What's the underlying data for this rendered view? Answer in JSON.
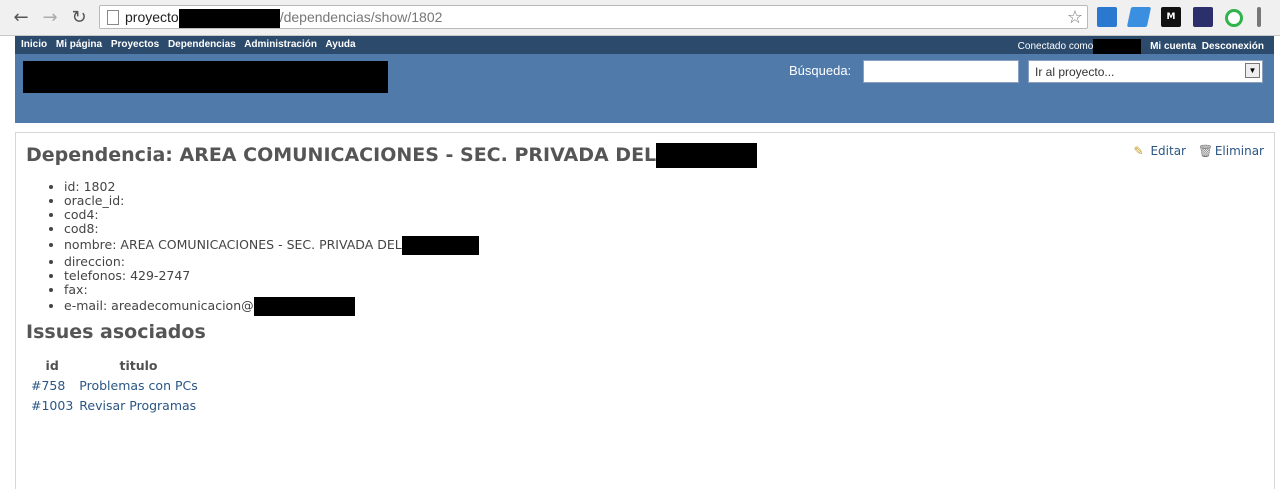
{
  "browser": {
    "url_host": "proyecto",
    "url_path": "/dependencias/show/1802"
  },
  "top_menu": {
    "items": [
      "Inicio",
      "Mi página",
      "Proyectos",
      "Dependencias",
      "Administración",
      "Ayuda"
    ],
    "logged_as": "Conectado como",
    "my_account": "Mi cuenta",
    "logout": "Desconexión"
  },
  "header": {
    "search_label": "Búsqueda:",
    "search_value": "",
    "jump_placeholder": "Ir al proyecto..."
  },
  "page": {
    "title": "Dependencia: AREA COMUNICACIONES - SEC. PRIVADA DEL",
    "edit_label": "Editar",
    "delete_label": "Eliminar",
    "details": [
      "id: 1802",
      "oracle_id:",
      "cod4:",
      "cod8:",
      "nombre: AREA COMUNICACIONES - SEC. PRIVADA DEL",
      "direccion:",
      "telefonos: 429-2747",
      "fax:",
      "e-mail: areadecomunicacion@"
    ],
    "issues_title": "Issues asociados",
    "issues_columns": [
      "id",
      "titulo"
    ],
    "issues": [
      {
        "id": "#758",
        "titulo": "Problemas con PCs"
      },
      {
        "id": "#1003",
        "titulo": "Revisar Programas"
      }
    ]
  }
}
